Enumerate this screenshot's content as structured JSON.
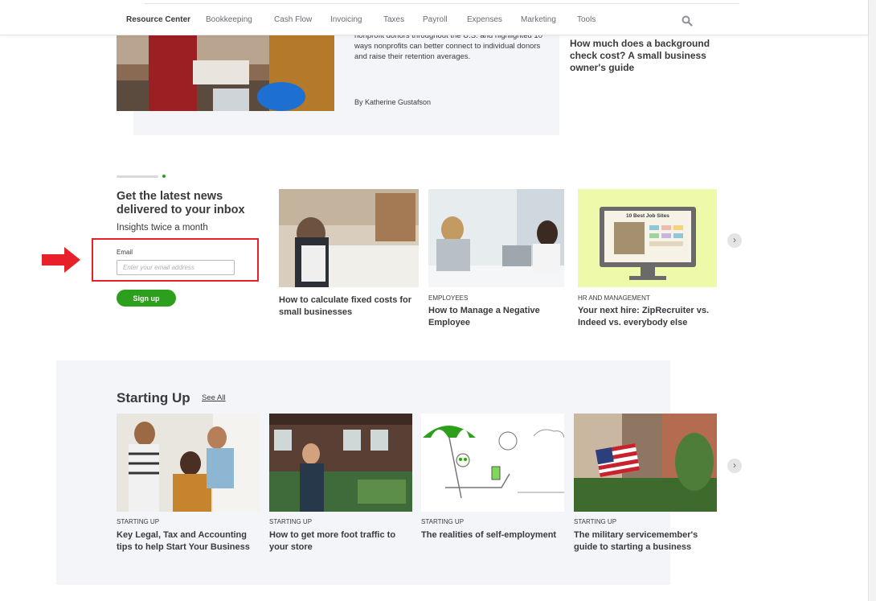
{
  "nav": {
    "items": [
      "Resource Center",
      "Bookkeeping",
      "Cash Flow",
      "Invoicing",
      "Taxes",
      "Payroll",
      "Expenses",
      "Marketing",
      "Tools"
    ],
    "active_index": 0
  },
  "top_article": {
    "description": "nonprofit donors throughout the U.S. and highlighted 10 ways nonprofits can better connect to individual donors and raise their retention averages.",
    "author": "By Katherine Gustafson"
  },
  "side_article": {
    "title": "How much does a background check cost? A small business owner's guide"
  },
  "newsletter": {
    "heading": "Get the latest news delivered to your inbox",
    "subheading": "Insights twice a month",
    "email_label": "Email",
    "email_placeholder": "Enter your email address",
    "email_value": "",
    "signup_label": "Sign up"
  },
  "news_cards": [
    {
      "category": "",
      "title": "How to calculate fixed costs for small businesses",
      "image": "cafe-worker-image"
    },
    {
      "category": "EMPLOYEES",
      "title": "How to Manage a Negative Employee",
      "image": "office-meeting-image"
    },
    {
      "category": "HR AND MANAGEMENT",
      "title": "Your next hire: ZipRecruiter vs. Indeed vs. everybody else",
      "image": "job-sites-monitor-image",
      "image_text": "10 Best Job Sites"
    }
  ],
  "starting_up": {
    "heading": "Starting Up",
    "see_all": "See All",
    "cards": [
      {
        "category": "STARTING UP",
        "title": "Key Legal, Tax and Accounting tips to help Start Your Business",
        "image": "team-celebrating-image"
      },
      {
        "category": "STARTING UP",
        "title": "How to get more foot traffic to your store",
        "image": "shop-owner-image"
      },
      {
        "category": "STARTING UP",
        "title": "The realities of self-employment",
        "image": "beach-illustration-image"
      },
      {
        "category": "STARTING UP",
        "title": "The military servicemember's guide to starting a business",
        "image": "american-flag-image"
      }
    ]
  },
  "colors": {
    "brand_green": "#2ca01c",
    "highlight_red": "#e8202a",
    "text": "#393a3d",
    "panel_grey": "#f4f5f8"
  }
}
